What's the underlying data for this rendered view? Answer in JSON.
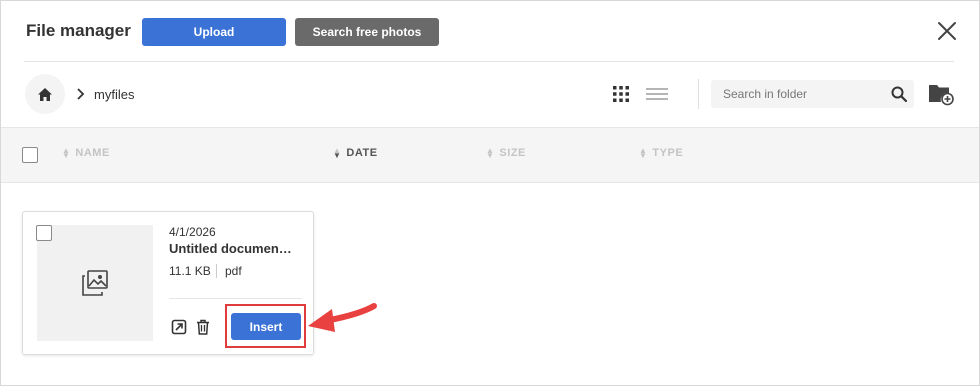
{
  "header": {
    "title": "File manager",
    "upload_label": "Upload",
    "search_photos_label": "Search free photos"
  },
  "breadcrumb": {
    "current": "myfiles"
  },
  "search": {
    "placeholder": "Search in folder"
  },
  "columns": [
    {
      "label": "NAME",
      "active": false
    },
    {
      "label": "DATE",
      "active": true
    },
    {
      "label": "SIZE",
      "active": false
    },
    {
      "label": "TYPE",
      "active": false
    }
  ],
  "files": [
    {
      "date": "4/1/2026",
      "name": "Untitled documen…",
      "size": "11.1 KB",
      "type": "pdf",
      "insert_label": "Insert"
    }
  ],
  "colors": {
    "accent": "#3a72d6",
    "secondary_button": "#6a6a6a",
    "highlight": "#e03c3c"
  },
  "icons": [
    "close-icon",
    "home-icon",
    "chevron-right-icon",
    "grid-view-icon",
    "list-view-icon",
    "search-icon",
    "new-folder-icon",
    "image-placeholder-icon",
    "open-external-icon",
    "trash-icon",
    "annotation-arrow"
  ]
}
